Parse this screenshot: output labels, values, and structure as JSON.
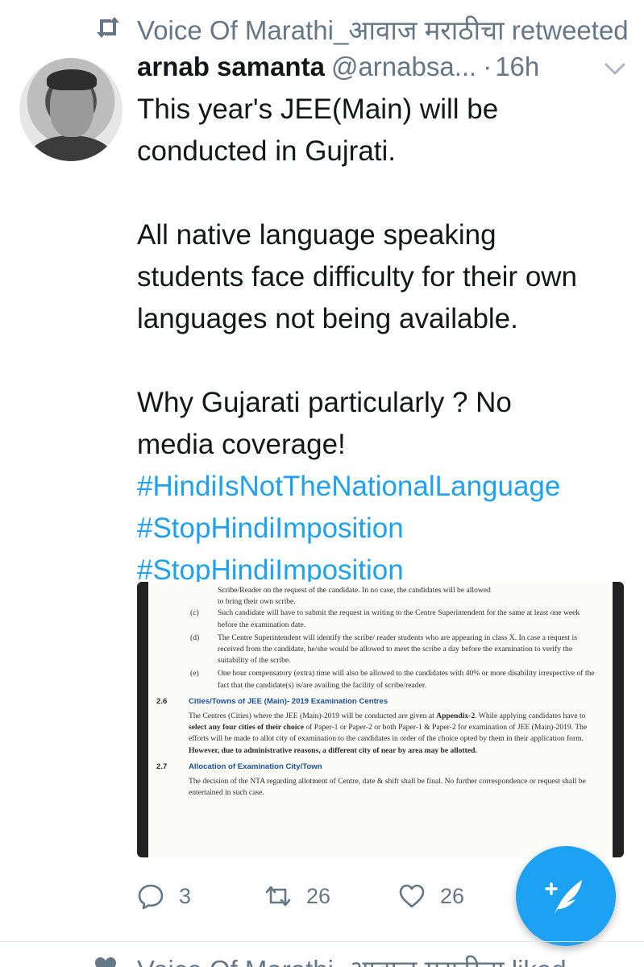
{
  "retweet_context": {
    "text": "Voice Of Marathi_आवाज मराठीचा retweeted",
    "icon": "retweet-icon"
  },
  "tweet": {
    "author_name": "arnab samanta",
    "author_handle": "@arnabsa...",
    "separator": "·",
    "time": "16h",
    "lines": [
      "This year's JEE(Main) will be",
      "conducted in Gujrati.",
      "All native language speaking",
      "students face difficulty for their own",
      "languages not being available.",
      "Why Gujarati particularly ?  No",
      "media coverage!"
    ],
    "hashtags": [
      "#HindiIsNotTheNationalLanguage",
      "#StopHindiImposition",
      "#StopHindiImposition"
    ]
  },
  "media_document": {
    "intro_line1": "Scribe/Reader on the request of the candidate. In no case, the candidates will be allowed",
    "intro_line2": "to bring their own scribe.",
    "items": [
      {
        "label": "(c)",
        "text": "Such candidate will have to submit the request in writing to the Centre Superintendent for the same at least one week before the examination date."
      },
      {
        "label": "(d)",
        "text": "The Centre Superintendent will identify the scribe/ reader students who are appearing in class X. In case a request is received from the candidate, he/she would be allowed to meet the scribe a day before the examination to verify the suitability of the scribe."
      },
      {
        "label": "(e)",
        "text": "One hour compensatory (extra) time will also be allowed to the candidates with 40% or more disability irrespective of the fact that the candidate(s) is/are availing the facility of scribe/reader."
      }
    ],
    "section_26_no": "2.6",
    "section_26_title": "Cities/Towns of JEE (Main)- 2019 Examination Centres",
    "section_26_part1": "The Centres (Cities) where the JEE (Main)-2019 will be conducted are given at ",
    "section_26_bold1": "Appendix-2",
    "section_26_part2": ". While applying candidates have to ",
    "section_26_bold2": "select any four cities of their choice",
    "section_26_part3": " of Paper-1 or Paper-2 or both Paper-1 & Paper-2 for examination of JEE (Main)-2019. The efforts will be made to allot city of examination to the candidates in order of the choice opted by them in their application form. ",
    "section_26_bold3": "However, due to administrative reasons, a different city of near by area may be allotted.",
    "section_27_no": "2.7",
    "section_27_title": "Allocation of Examination City/Town",
    "section_27_text": "The decision of the NTA regarding allotment of Centre, date & shift shall be final. No further correspondence or request shall be entertained in such case."
  },
  "actions": {
    "reply_count": "3",
    "retweet_count": "26",
    "like_count": "26"
  },
  "next_context": {
    "text": "Voice Of Marathi_आवाज मराठीचा liked"
  },
  "colors": {
    "accent": "#1da1f2",
    "secondary_text": "#657786",
    "primary_text": "#14171a"
  }
}
